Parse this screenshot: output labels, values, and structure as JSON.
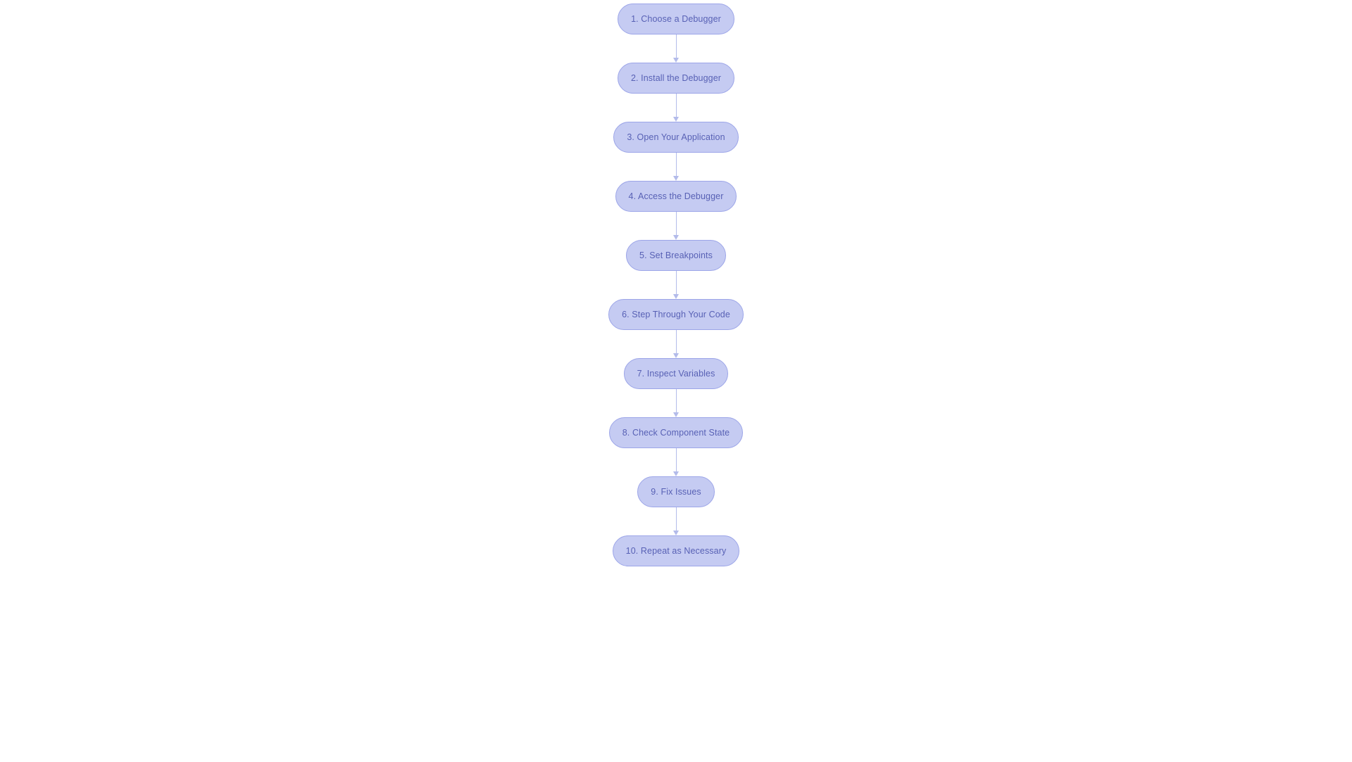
{
  "flowchart": {
    "nodes": [
      {
        "label": "1. Choose a Debugger"
      },
      {
        "label": "2. Install the Debugger"
      },
      {
        "label": "3. Open Your Application"
      },
      {
        "label": "4. Access the Debugger"
      },
      {
        "label": "5. Set Breakpoints"
      },
      {
        "label": "6. Step Through Your Code"
      },
      {
        "label": "7. Inspect Variables"
      },
      {
        "label": "8. Check Component State"
      },
      {
        "label": "9. Fix Issues"
      },
      {
        "label": "10. Repeat as Necessary"
      }
    ]
  },
  "colors": {
    "node_fill": "#c5cbf2",
    "node_border": "#9ca5e8",
    "node_text": "#5861b5",
    "connector": "#b3bbea"
  }
}
